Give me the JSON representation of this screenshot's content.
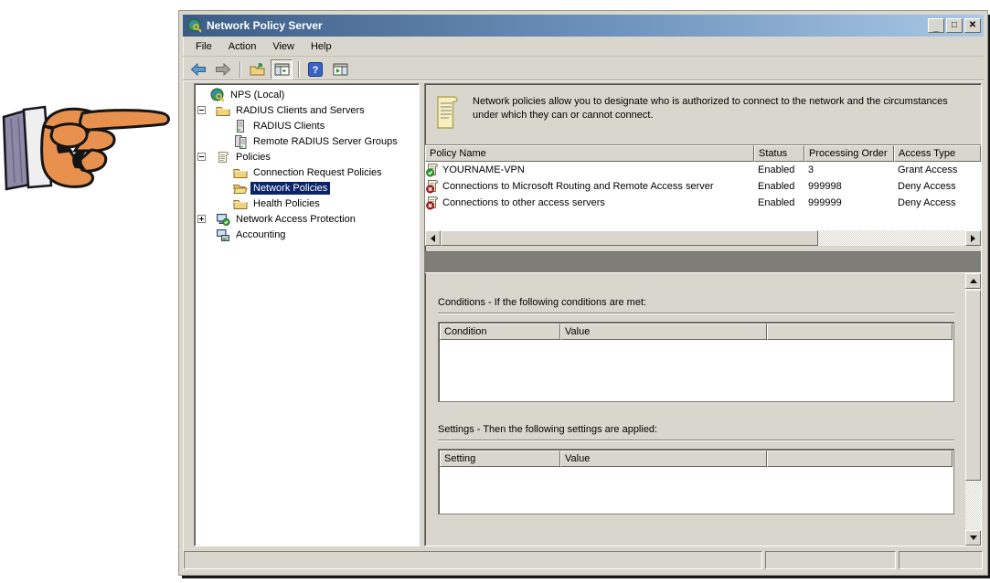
{
  "window": {
    "title": "Network Policy Server",
    "controls": {
      "minimize": "_",
      "maximize": "□",
      "close": "✕"
    }
  },
  "menubar": {
    "items": [
      "File",
      "Action",
      "View",
      "Help"
    ]
  },
  "toolbar": {
    "icons": [
      "back-icon",
      "forward-icon",
      "export-list-icon",
      "show-hide-console-tree-icon",
      "help-icon",
      "show-hide-action-pane-icon"
    ]
  },
  "sidebar": {
    "items": [
      {
        "label": "NPS (Local)",
        "depth": 0,
        "expander": "none",
        "icon": "nps-server-icon",
        "selected": false
      },
      {
        "label": "RADIUS Clients and Servers",
        "depth": 1,
        "expander": "minus",
        "icon": "folder-icon",
        "selected": false
      },
      {
        "label": "RADIUS Clients",
        "depth": 2,
        "expander": "none",
        "icon": "server-icon",
        "selected": false
      },
      {
        "label": "Remote RADIUS Server Groups",
        "depth": 2,
        "expander": "none",
        "icon": "server-group-icon",
        "selected": false
      },
      {
        "label": "Policies",
        "depth": 1,
        "expander": "minus",
        "icon": "policy-scroll-icon",
        "selected": false
      },
      {
        "label": "Connection Request Policies",
        "depth": 2,
        "expander": "none",
        "icon": "folder-icon",
        "selected": false
      },
      {
        "label": "Network Policies",
        "depth": 2,
        "expander": "none",
        "icon": "folder-open-icon",
        "selected": true
      },
      {
        "label": "Health Policies",
        "depth": 2,
        "expander": "none",
        "icon": "folder-icon",
        "selected": false
      },
      {
        "label": "Network Access Protection",
        "depth": 1,
        "expander": "plus",
        "icon": "nap-computer-icon",
        "selected": false
      },
      {
        "label": "Accounting",
        "depth": 1,
        "expander": "none",
        "icon": "accounting-icon",
        "selected": false
      }
    ]
  },
  "main": {
    "banner_text": "Network policies allow you to designate who is authorized to connect to the network and the circumstances under which they can or cannot connect.",
    "policies": {
      "columns": [
        "Policy Name",
        "Status",
        "Processing Order",
        "Access Type"
      ],
      "rows": [
        {
          "icon": "policy-grant-icon",
          "name": "YOURNAME-VPN",
          "status": "Enabled",
          "order": "3",
          "access": "Grant Access"
        },
        {
          "icon": "policy-deny-icon",
          "name": "Connections to Microsoft Routing and Remote Access server",
          "status": "Enabled",
          "order": "999998",
          "access": "Deny Access"
        },
        {
          "icon": "policy-deny-icon",
          "name": "Connections to other access servers",
          "status": "Enabled",
          "order": "999999",
          "access": "Deny Access"
        }
      ]
    },
    "conditions": {
      "heading": "Conditions - If the following conditions are met:",
      "columns": [
        "Condition",
        "Value"
      ]
    },
    "settings": {
      "heading": "Settings - Then the following settings are applied:",
      "columns": [
        "Setting",
        "Value"
      ]
    }
  },
  "colors": {
    "title_gradient_start": "#3c5c85",
    "title_gradient_end": "#a9c8e6",
    "selection": "#0a246a",
    "face": "#d9d6cd",
    "separator_band": "#7f7d78",
    "grant_badge": "#2da12d",
    "deny_badge": "#c32222"
  }
}
